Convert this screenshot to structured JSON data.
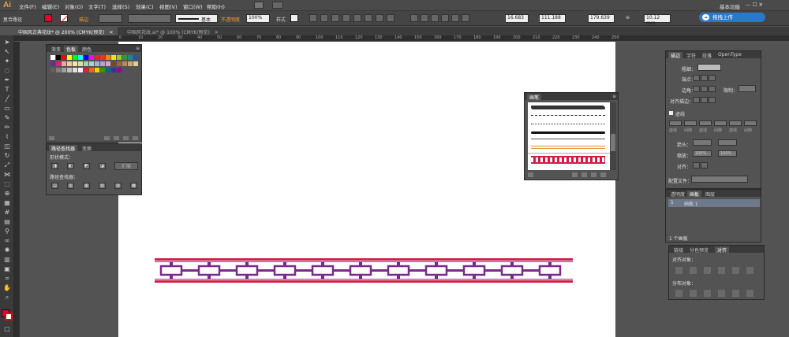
{
  "app": {
    "logo": "Ai",
    "workspace": "基本功能"
  },
  "menu": [
    "文件(F)",
    "编辑(E)",
    "对象(O)",
    "文字(T)",
    "选择(S)",
    "效果(C)",
    "视图(V)",
    "窗口(W)",
    "帮助(H)"
  ],
  "control": {
    "selection_label": "复合路径",
    "stroke_label": "描边",
    "brush_label": "基本",
    "opacity_label": "不透明度",
    "opacity_value": "100%",
    "style_label": "样式",
    "w_value": "16.683",
    "x_value": "111.188",
    "y_value": "179.639",
    "h_value": "10.12 mm",
    "upload_label": "拖拽上传"
  },
  "tabs": [
    {
      "label": "中国风古典花纹* @ 200% (CMYK/预览)"
    },
    {
      "label": "中国风花纹.ai* @ 100% (CMYK/预览)"
    }
  ],
  "ruler_numbers": [
    "0",
    "10",
    "20",
    "30",
    "40",
    "50",
    "60",
    "70",
    "80",
    "90",
    "100",
    "110",
    "120",
    "130",
    "140",
    "150",
    "160",
    "170",
    "180",
    "190",
    "200",
    "210",
    "220",
    "230",
    "240",
    "250"
  ],
  "swatches_panel": {
    "tabs": [
      "渐变",
      "色板",
      "颜色"
    ],
    "colors": [
      "#ffffff",
      "#000000",
      "#ff0000",
      "#ffff00",
      "#00ff00",
      "#00ffff",
      "#0000ff",
      "#ff00ff",
      "#e6262d",
      "#e8381c",
      "#f08a00",
      "#ffe100",
      "#a0c814",
      "#2a9b3c",
      "#1c8a8c",
      "#1e5aa0",
      "#6a2e8c",
      "#c8286e",
      "#f4a0a0",
      "#f7c7a0",
      "#fae6a0",
      "#cfe6a0",
      "#a0d6b4",
      "#a0d2d8",
      "#a0b4dc",
      "#b4a0d2",
      "#e0a0c8",
      "#7a4a1e",
      "#946a3a",
      "#b48c5a",
      "#c8aa78",
      "#e0cca0",
      "#606060",
      "#808080",
      "#a0a0a0",
      "#c0c0c0",
      "#e0e0e0",
      "#f0f0f0",
      "#d22",
      "#e60",
      "#fc0",
      "#390",
      "#069",
      "#339",
      "#909"
    ]
  },
  "pathfinder_panel": {
    "tabs": [
      "路径查找器",
      "变换"
    ],
    "shape_modes_label": "形状模式：",
    "expand_label": "扩展",
    "pathfinder_label": "路径查找器："
  },
  "brushes_panel": {
    "tabs": [
      "画笔"
    ]
  },
  "stroke_panel": {
    "tabs": [
      "描边",
      "字符",
      "段落",
      "OpenType"
    ],
    "weight_label": "粗细：",
    "cap_label": "端点：",
    "corner_label": "边角：",
    "limit_label": "限制：",
    "align_label": "对齐描边：",
    "dashed_label": "虚线",
    "dash_labels": [
      "虚线",
      "间隙",
      "虚线",
      "间隙",
      "虚线",
      "间隙"
    ],
    "arrow_label": "箭头：",
    "scale_label": "缩放：",
    "scale_value": "100%",
    "align2_label": "对齐：",
    "profile_label": "配置文件："
  },
  "layers_panel": {
    "tabs": [
      "透明度",
      "画板",
      "图层"
    ],
    "row_index": "1",
    "row_name": "画板 1",
    "footer": "1 个画板"
  },
  "align_panel": {
    "tabs": [
      "链接",
      "分色预览",
      "对齐"
    ],
    "align_objects_label": "对齐对象：",
    "distribute_label": "分布对象："
  },
  "colors": {
    "pattern_red": "#d21c44",
    "pattern_purple": "#7a2a8a",
    "accent_blue": "#2a78c8"
  }
}
